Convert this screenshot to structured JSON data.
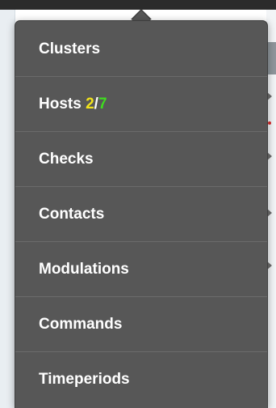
{
  "menu": {
    "items": [
      {
        "label": "Clusters"
      },
      {
        "label": "Hosts",
        "count_warn": "2",
        "separator": "/",
        "count_ok": "7"
      },
      {
        "label": "Checks"
      },
      {
        "label": "Contacts"
      },
      {
        "label": "Modulations"
      },
      {
        "label": "Commands"
      },
      {
        "label": "Timeperiods"
      }
    ]
  },
  "colors": {
    "menu_bg": "#575757",
    "text": "#ffffff",
    "warn": "#f2e21b",
    "ok": "#3fdc1f"
  }
}
